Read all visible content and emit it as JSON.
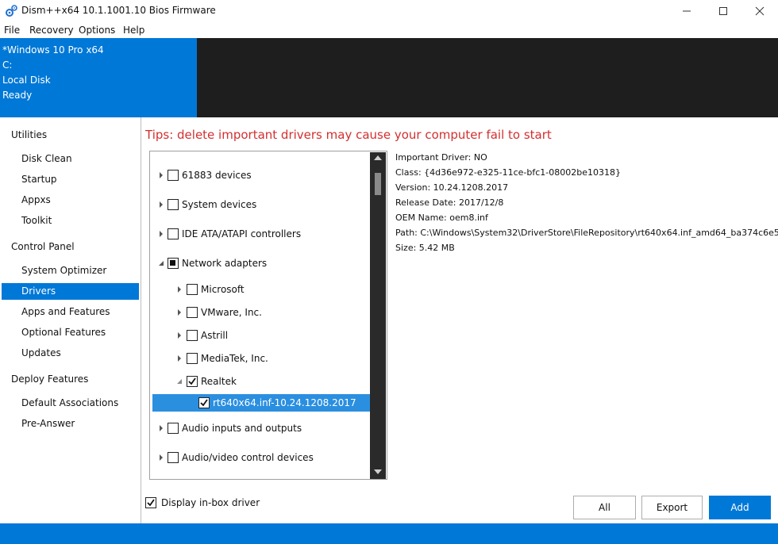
{
  "window": {
    "title": "Dism++x64 10.1.1001.10 Bios Firmware"
  },
  "menu": [
    "File",
    "Recovery",
    "Options",
    "Help"
  ],
  "header": {
    "os": "*Windows 10 Pro x64",
    "drive": "C:",
    "disk": "Local Disk",
    "status": "Ready"
  },
  "sidebar": {
    "sections": [
      "Utilities",
      "Control Panel",
      "Deploy Features"
    ],
    "utilities": [
      "Disk Clean",
      "Startup",
      "Appxs",
      "Toolkit"
    ],
    "control_panel": [
      "System Optimizer",
      "Drivers",
      "Apps and Features",
      "Optional Features",
      "Updates"
    ],
    "deploy": [
      "Default Associations",
      "Pre-Answer"
    ]
  },
  "tips": "Tips: delete important drivers may cause your computer fail to start",
  "tree": [
    {
      "label": "61883 devices",
      "state": "unchecked"
    },
    {
      "label": "System devices",
      "state": "unchecked"
    },
    {
      "label": "IDE ATA/ATAPI controllers",
      "state": "unchecked"
    },
    {
      "label": "Network adapters",
      "state": "partial"
    },
    {
      "label": "Microsoft",
      "state": "unchecked"
    },
    {
      "label": "VMware, Inc.",
      "state": "unchecked"
    },
    {
      "label": "Astrill",
      "state": "unchecked"
    },
    {
      "label": "MediaTek, Inc.",
      "state": "unchecked"
    },
    {
      "label": "Realtek",
      "state": "checked"
    },
    {
      "label": "rt640x64.inf-10.24.1208.2017",
      "state": "checked"
    },
    {
      "label": "Audio inputs and outputs",
      "state": "unchecked"
    },
    {
      "label": "Audio/video control devices",
      "state": "unchecked"
    }
  ],
  "details": [
    "Important Driver: NO",
    "Class: {4d36e972-e325-11ce-bfc1-08002be10318}",
    "Version: 10.24.1208.2017",
    "Release Date: 2017/12/8",
    "OEM Name: oem8.inf",
    "Path: C:\\Windows\\System32\\DriverStore\\FileRepository\\rt640x64.inf_amd64_ba374c6e5",
    "Size: 5.42 MB"
  ],
  "inbox_label": "Display in-box driver",
  "buttons": {
    "all": "All",
    "export": "Export",
    "add": "Add"
  },
  "colors": {
    "accent": "#0078d7",
    "tips": "#d32f2f",
    "selection": "#2b8fe0"
  },
  "icons": {
    "app": "gears-icon",
    "expand": "triangle-right-icon",
    "collapse": "triangle-down-icon"
  }
}
